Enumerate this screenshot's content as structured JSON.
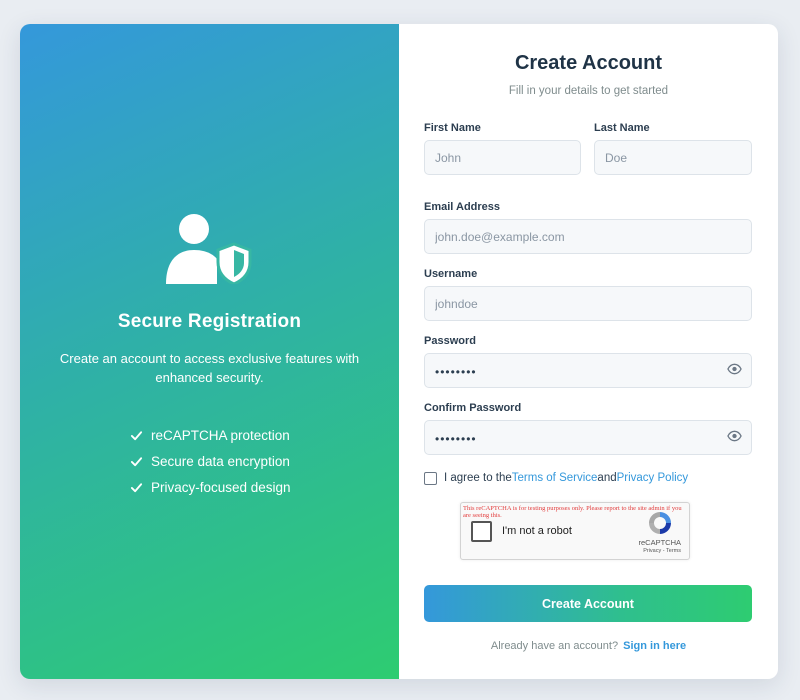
{
  "hero": {
    "icon": "user-shield-icon",
    "title": "Secure Registration",
    "description": "Create an account to access exclusive features with enhanced security.",
    "features": [
      {
        "icon": "check-icon",
        "label": "reCAPTCHA protection"
      },
      {
        "icon": "check-icon",
        "label": "Secure data encryption"
      },
      {
        "icon": "check-icon",
        "label": "Privacy-focused design"
      }
    ]
  },
  "form": {
    "title": "Create Account",
    "subtitle": "Fill in your details to get started",
    "first_name": {
      "label": "First Name",
      "placeholder": "John",
      "value": ""
    },
    "last_name": {
      "label": "Last Name",
      "placeholder": "Doe",
      "value": ""
    },
    "email": {
      "label": "Email Address",
      "placeholder": "john.doe@example.com",
      "value": ""
    },
    "username": {
      "label": "Username",
      "placeholder": "johndoe",
      "value": ""
    },
    "password": {
      "label": "Password",
      "masked_value": "••••••••",
      "toggle_icon": "eye-icon"
    },
    "confirm_password": {
      "label": "Confirm Password",
      "masked_value": "••••••••",
      "toggle_icon": "eye-icon"
    },
    "agree": {
      "prefix": "I agree to the",
      "terms_link": "Terms of Service",
      "conjunction": "and",
      "privacy_link": "Privacy Policy",
      "checked": false
    },
    "recaptcha": {
      "warning": "This reCAPTCHA is for testing purposes only. Please report to the site admin if you are seeing this.",
      "label": "I'm not a robot",
      "brand": "reCAPTCHA",
      "terms": "Privacy - Terms",
      "checked": false
    },
    "submit_label": "Create Account",
    "signin_prompt": "Already have an account?",
    "signin_link": "Sign in here"
  },
  "colors": {
    "accent_blue": "#3498db",
    "accent_green": "#2ecc71",
    "text_dark": "#2c3e50",
    "text_muted": "#7f8c8d"
  }
}
